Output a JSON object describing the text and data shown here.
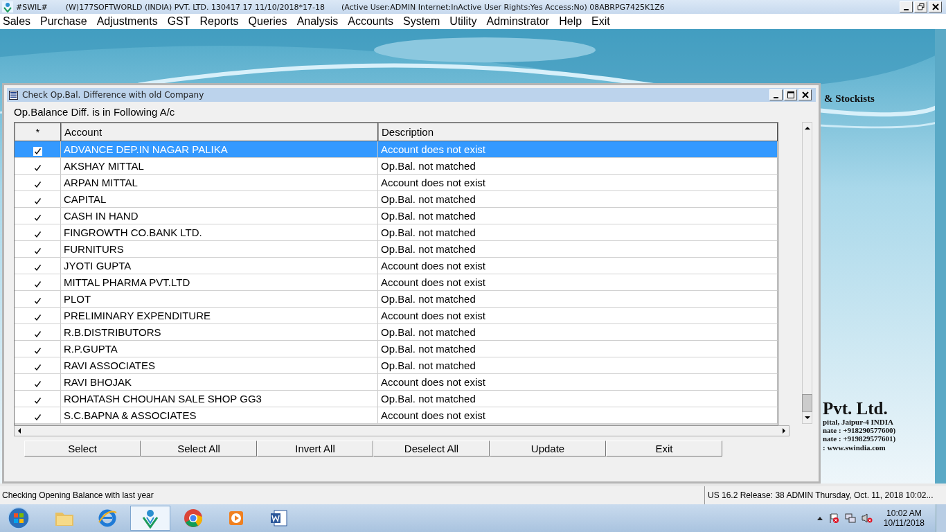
{
  "app_title": {
    "name": "#SWIL#",
    "info": "(W)177SOFTWORLD (INDIA) PVT. LTD. 130417 17   11/10/2018*17-18",
    "session": "(Active User:ADMIN Internet:InActive User Rights:Yes Access:No) 08ABRPG7425K1Z6"
  },
  "menu": [
    "Sales",
    "Purchase",
    "Adjustments",
    "GST",
    "Reports",
    "Queries",
    "Analysis",
    "Accounts",
    "System",
    "Utility",
    "Adminstrator",
    "Help",
    "Exit"
  ],
  "background_logo": {
    "tagline": "& Stockists",
    "company": "Pvt. Ltd.",
    "lines": [
      "pital, Jaipur-4 INDIA",
      "nate : +918290577600)",
      "nate : +919829577601)",
      ": www.swindia.com"
    ]
  },
  "dialog": {
    "title": "Check Op.Bal. Difference with old Company",
    "caption": "Op.Balance Diff. is in Following A/c",
    "columns": [
      "*",
      "Account",
      "Description"
    ],
    "rows": [
      {
        "checked": true,
        "selected": true,
        "account": "ADVANCE DEP.IN NAGAR PALIKA",
        "description": "Account does not exist"
      },
      {
        "checked": true,
        "selected": false,
        "account": "AKSHAY MITTAL",
        "description": "Op.Bal. not matched"
      },
      {
        "checked": true,
        "selected": false,
        "account": "ARPAN MITTAL",
        "description": "Account does not exist"
      },
      {
        "checked": true,
        "selected": false,
        "account": "CAPITAL",
        "description": "Op.Bal. not matched"
      },
      {
        "checked": true,
        "selected": false,
        "account": "CASH IN HAND",
        "description": "Op.Bal. not matched"
      },
      {
        "checked": true,
        "selected": false,
        "account": "FINGROWTH CO.BANK LTD.",
        "description": "Op.Bal. not matched"
      },
      {
        "checked": true,
        "selected": false,
        "account": "FURNITURS",
        "description": "Op.Bal. not matched"
      },
      {
        "checked": true,
        "selected": false,
        "account": "JYOTI GUPTA",
        "description": "Account does not exist"
      },
      {
        "checked": true,
        "selected": false,
        "account": "MITTAL PHARMA PVT.LTD",
        "description": "Account does not exist"
      },
      {
        "checked": true,
        "selected": false,
        "account": "PLOT",
        "description": "Op.Bal. not matched"
      },
      {
        "checked": true,
        "selected": false,
        "account": "PRELIMINARY EXPENDITURE",
        "description": "Account does not exist"
      },
      {
        "checked": true,
        "selected": false,
        "account": "R.B.DISTRIBUTORS",
        "description": "Op.Bal. not matched"
      },
      {
        "checked": true,
        "selected": false,
        "account": "R.P.GUPTA",
        "description": "Op.Bal. not matched"
      },
      {
        "checked": true,
        "selected": false,
        "account": "RAVI ASSOCIATES",
        "description": "Op.Bal. not matched"
      },
      {
        "checked": true,
        "selected": false,
        "account": "RAVI BHOJAK",
        "description": "Account does not exist"
      },
      {
        "checked": true,
        "selected": false,
        "account": "ROHATASH CHOUHAN SALE SHOP GG3",
        "description": "Op.Bal. not matched"
      },
      {
        "checked": true,
        "selected": false,
        "account": "S.C.BAPNA & ASSOCIATES",
        "description": "Account does not exist"
      }
    ],
    "buttons": [
      "Select",
      "Select All",
      "Invert All",
      "Deselect All",
      "Update",
      "Exit"
    ]
  },
  "status_bar": {
    "message": "Checking Opening Balance with last year",
    "info": "US 16.2 Release: 38  ADMIN  Thursday, Oct. 11, 2018  10:02..."
  },
  "taskbar": {
    "apps": [
      {
        "kind": "folder",
        "selected": false
      },
      {
        "kind": "browser",
        "selected": false
      },
      {
        "kind": "app",
        "selected": true
      },
      {
        "kind": "chrome",
        "selected": false
      },
      {
        "kind": "media",
        "selected": false
      },
      {
        "kind": "word",
        "selected": false
      }
    ],
    "time": "10:02 AM",
    "date": "10/11/2018"
  }
}
